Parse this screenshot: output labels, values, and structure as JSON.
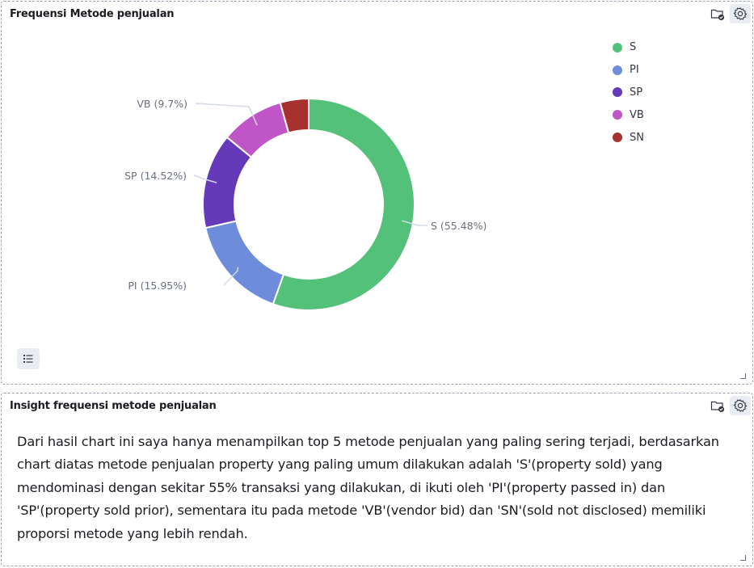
{
  "panels": {
    "chart": {
      "title": "Frequensi Metode penjualan"
    },
    "insight": {
      "title": "Insight frequensi metode penjualan",
      "text": "Dari hasil chart ini saya hanya menampilkan top 5 metode penjualan yang paling sering terjadi, berdasarkan chart diatas metode penjualan property yang paling umum dilakukan adalah 'S'(property sold) yang mendominasi dengan sekitar 55% transaksi yang dilakukan, di ikuti oleh 'PI'(property passed in) dan 'SP'(property sold prior), sementara itu pada metode 'VB'(vendor bid) dan 'SN'(sold not disclosed) memiliki proporsi metode yang lebih rendah."
    }
  },
  "icons": {
    "panel_menu": "folder-check-icon",
    "settings": "gear-icon",
    "legend_toggle": "list-icon"
  },
  "chart_data": {
    "type": "pie",
    "donut": true,
    "title": "Frequensi Metode penjualan",
    "legend_position": "top-right",
    "slices": [
      {
        "name": "S",
        "percent": 55.48,
        "label": "S (55.48%)",
        "color": "#54c17a"
      },
      {
        "name": "PI",
        "percent": 15.95,
        "label": "PI (15.95%)",
        "color": "#6d8ddc"
      },
      {
        "name": "SP",
        "percent": 14.52,
        "label": "SP (14.52%)",
        "color": "#6539b9"
      },
      {
        "name": "VB",
        "percent": 9.7,
        "label": "VB (9.7%)",
        "color": "#c055c8"
      },
      {
        "name": "SN",
        "percent": 4.35,
        "label": "SN",
        "color": "#a7312f"
      }
    ]
  }
}
